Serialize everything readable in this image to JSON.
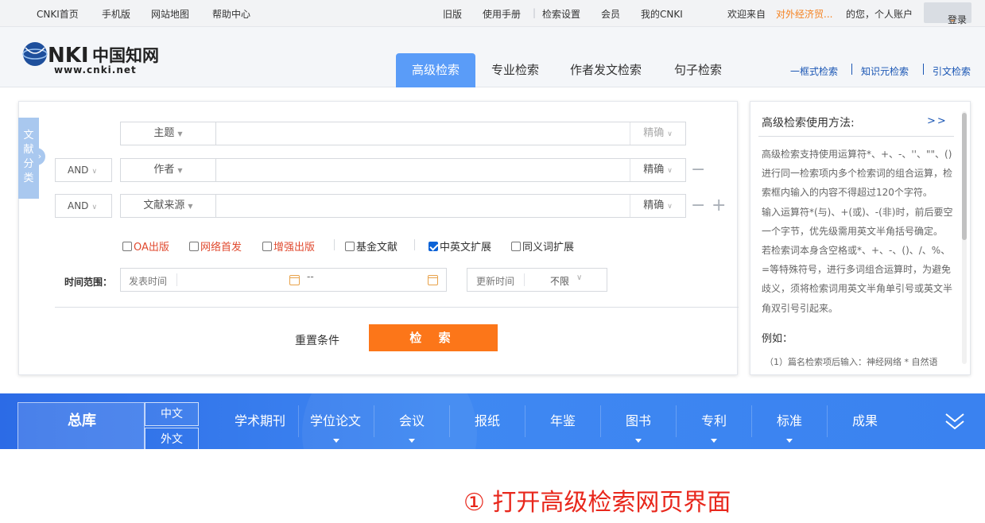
{
  "topbar": {
    "home": "CNKI首页",
    "mobile": "手机版",
    "sitemap": "网站地图",
    "help": "帮助中心",
    "old": "旧版",
    "manual": "使用手册",
    "settings": "检索设置",
    "member": "会员",
    "mycnki": "我的CNKI",
    "welcome": "欢迎来自",
    "org": "对外经济贸...",
    "greeting": "的您，个人账户",
    "login": "登录"
  },
  "header": {
    "logo_text": "www.cnki.net",
    "logo_cn": "中国知网",
    "tabs": [
      "高级检索",
      "专业检索",
      "作者发文检索",
      "句子检索"
    ],
    "links": [
      "一框式检索",
      "知识元检索",
      "引文检索"
    ]
  },
  "search": {
    "side_tab": "文献分类",
    "rows": [
      {
        "field": "主题",
        "match": "精确"
      },
      {
        "logic": "AND",
        "field": "作者",
        "match": "精确"
      },
      {
        "logic": "AND",
        "field": "文献来源",
        "match": "精确"
      }
    ],
    "checkboxes": [
      {
        "label": "OA出版",
        "checked": false,
        "red": true
      },
      {
        "label": "网络首发",
        "checked": false,
        "red": true
      },
      {
        "label": "增强出版",
        "checked": false,
        "red": true
      },
      {
        "label": "基金文献",
        "checked": false,
        "red": false
      },
      {
        "label": "中英文扩展",
        "checked": true,
        "red": false
      },
      {
        "label": "同义词扩展",
        "checked": false,
        "red": false
      }
    ],
    "time_label": "时间范围：",
    "pub_time": "发表时间",
    "range_sep": "--",
    "update_time": "更新时间",
    "update_value": "不限",
    "reset": "重置条件",
    "submit": "检 索"
  },
  "help": {
    "title": "高级检索使用方法:",
    "more": ">>",
    "paragraphs": [
      "高级检索支持使用运算符*、+、-、''、\"\"、()进行同一检索项内多个检索词的组合运算，检索框内输入的内容不得超过120个字符。",
      "输入运算符*(与)、+(或)、-(非)时，前后要空一个字节，优先级需用英文半角括号确定。",
      "若检索词本身含空格或*、+、-、()、/、%、=等特殊符号，进行多词组合运算时，为避免歧义，须将检索词用英文半角单引号或英文半角双引号引起来。"
    ],
    "example_title": "例如：",
    "example_1": "（1）篇名检索项后输入：神经网络 * 自然语"
  },
  "dbbar": {
    "main": "总库",
    "lang_cn": "中文",
    "lang_en": "外文",
    "items": [
      "学术期刊",
      "学位论文",
      "会议",
      "报纸",
      "年鉴",
      "图书",
      "专利",
      "标准",
      "成果"
    ]
  },
  "caption": "① 打开高级检索网页界面"
}
